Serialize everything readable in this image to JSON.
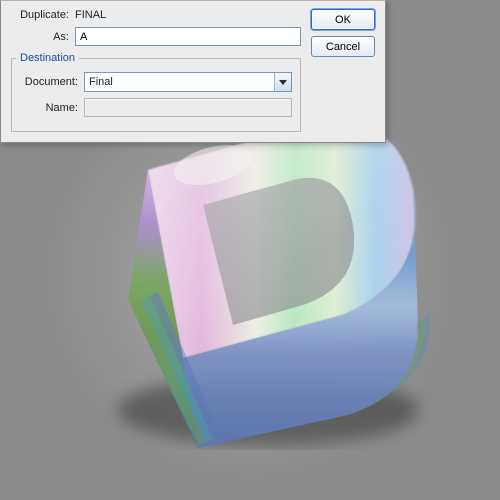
{
  "dialog": {
    "duplicate_label": "Duplicate:",
    "duplicate_value": "FINAL",
    "as_label": "As:",
    "as_value": "A",
    "destination_legend": "Destination",
    "document_label": "Document:",
    "document_value": "Final",
    "name_label": "Name:",
    "name_value": "",
    "ok_label": "OK",
    "cancel_label": "Cancel"
  }
}
